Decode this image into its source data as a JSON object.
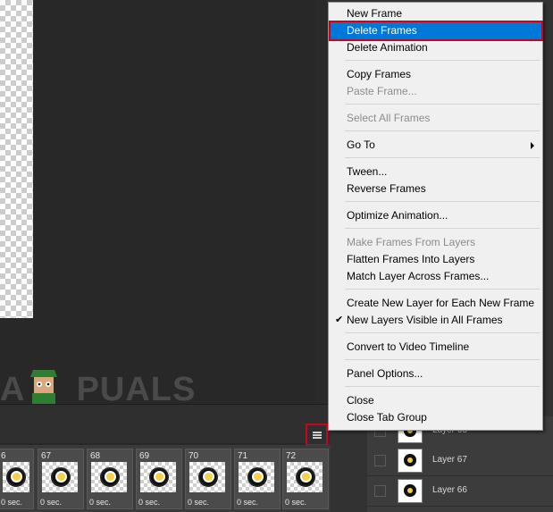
{
  "watermark": {
    "text_prefix": "A",
    "text_suffix": "PUALS"
  },
  "context_menu": {
    "items": [
      {
        "label": "New Frame",
        "state": "enabled"
      },
      {
        "label": "Delete Frames",
        "state": "highlighted"
      },
      {
        "label": "Delete Animation",
        "state": "enabled"
      },
      {
        "label": "Copy Frames",
        "state": "enabled"
      },
      {
        "label": "Paste Frame...",
        "state": "disabled"
      },
      {
        "label": "Select All Frames",
        "state": "disabled"
      },
      {
        "label": "Go To",
        "state": "enabled",
        "submenu": true
      },
      {
        "label": "Tween...",
        "state": "enabled"
      },
      {
        "label": "Reverse Frames",
        "state": "enabled"
      },
      {
        "label": "Optimize Animation...",
        "state": "enabled"
      },
      {
        "label": "Make Frames From Layers",
        "state": "disabled"
      },
      {
        "label": "Flatten Frames Into Layers",
        "state": "enabled"
      },
      {
        "label": "Match Layer Across Frames...",
        "state": "enabled"
      },
      {
        "label": "Create New Layer for Each New Frame",
        "state": "enabled"
      },
      {
        "label": "New Layers Visible in All Frames",
        "state": "enabled",
        "checked": true,
        "check_glyph": "✔"
      },
      {
        "label": "Convert to Video Timeline",
        "state": "enabled"
      },
      {
        "label": "Panel Options...",
        "state": "enabled"
      },
      {
        "label": "Close",
        "state": "enabled"
      },
      {
        "label": "Close Tab Group",
        "state": "enabled"
      }
    ]
  },
  "timeline": {
    "frames": [
      {
        "number": "6",
        "delay": "0 sec."
      },
      {
        "number": "67",
        "delay": "0 sec."
      },
      {
        "number": "68",
        "delay": "0 sec."
      },
      {
        "number": "69",
        "delay": "0 sec."
      },
      {
        "number": "70",
        "delay": "0 sec."
      },
      {
        "number": "71",
        "delay": "0 sec."
      },
      {
        "number": "72",
        "delay": "0 sec."
      }
    ]
  },
  "layers": {
    "rows": [
      {
        "name": "Layer 68"
      },
      {
        "name": "Layer 67"
      },
      {
        "name": "Layer 66"
      }
    ]
  },
  "colors": {
    "menu_highlight": "#0078d7",
    "annotation_red": "#d0021b",
    "workspace_bg": "#282828"
  }
}
